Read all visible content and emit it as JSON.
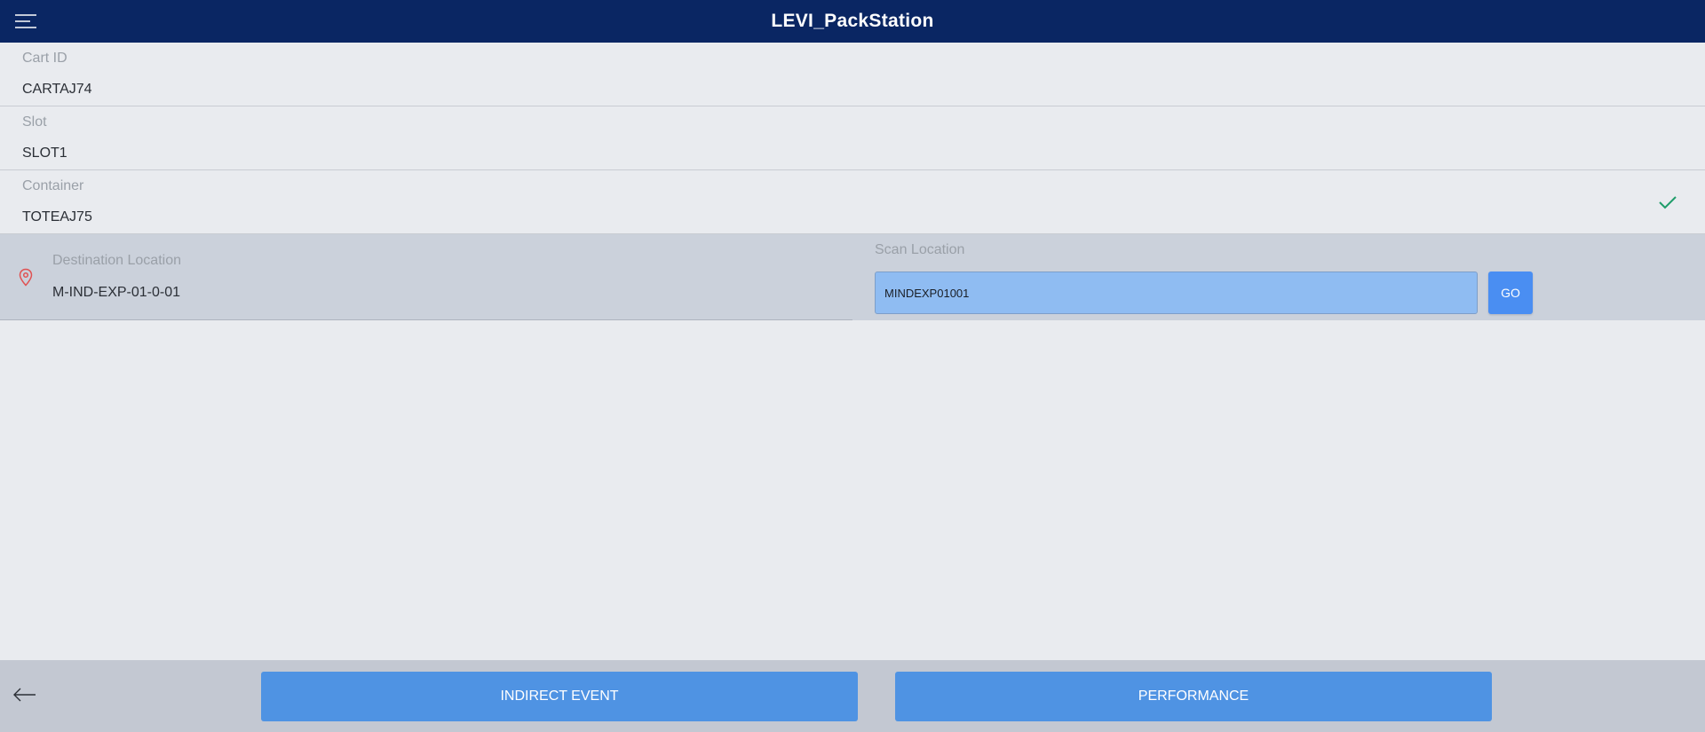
{
  "header": {
    "title": "LEVI_PackStation",
    "menu_icon": "hamburger-menu-icon"
  },
  "cart": {
    "label": "Cart ID",
    "value": "CARTAJ74"
  },
  "slot": {
    "label": "Slot",
    "value": "SLOT1"
  },
  "container": {
    "label": "Container",
    "value": "TOTEAJ75",
    "status_icon": "check-icon"
  },
  "destination": {
    "label": "Destination Location",
    "value": "M-IND-EXP-01-0-01",
    "icon": "location-pin-icon"
  },
  "scan": {
    "label": "Scan Location",
    "input_value": "MINDEXP01001",
    "go_label": "GO"
  },
  "footer": {
    "back_icon": "back-arrow-icon",
    "indirect_event_label": "INDIRECT EVENT",
    "performance_label": "PERFORMANCE"
  },
  "colors": {
    "header_bg": "#0a2663",
    "accent_blue": "#4f93e3",
    "check_green": "#1f9d6a",
    "pin_red": "#e05252"
  }
}
